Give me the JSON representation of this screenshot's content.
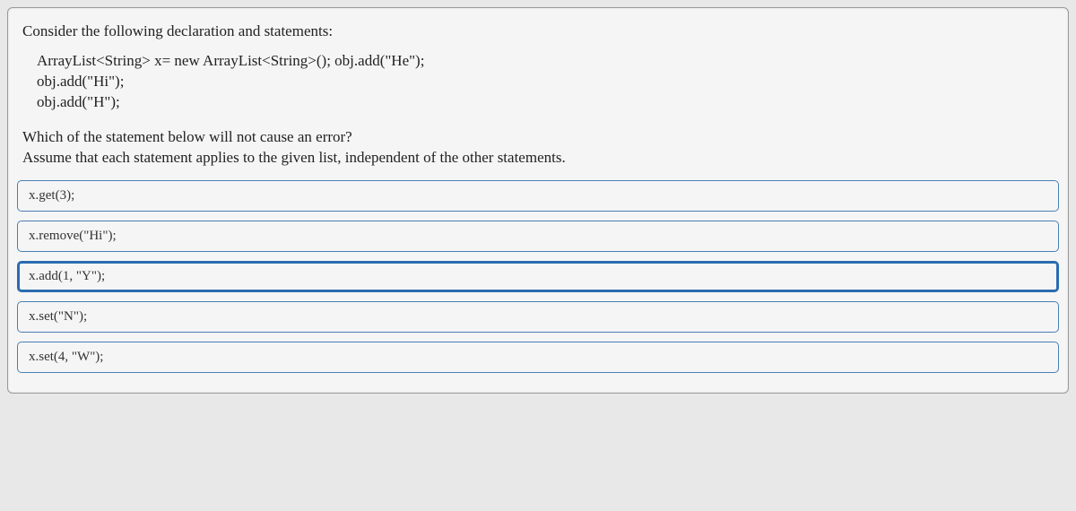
{
  "question": {
    "intro": "Consider the following declaration and statements:",
    "code_line1": "ArrayList<String> x= new ArrayList<String>(); obj.add(\"He\");",
    "code_line2": "obj.add(\"Hi\");",
    "code_line3": "obj.add(\"H\");",
    "followup_line1": "Which of the statement below will not cause an error?",
    "followup_line2": "Assume that each statement applies to the given list, independent of the other statements."
  },
  "options": [
    {
      "label": "x.get(3);",
      "selected": false
    },
    {
      "label": "x.remove(\"Hi\");",
      "selected": false
    },
    {
      "label": "x.add(1, \"Y\");",
      "selected": true
    },
    {
      "label": "x.set(\"N\");",
      "selected": false
    },
    {
      "label": "x.set(4, \"W\");",
      "selected": false
    }
  ]
}
